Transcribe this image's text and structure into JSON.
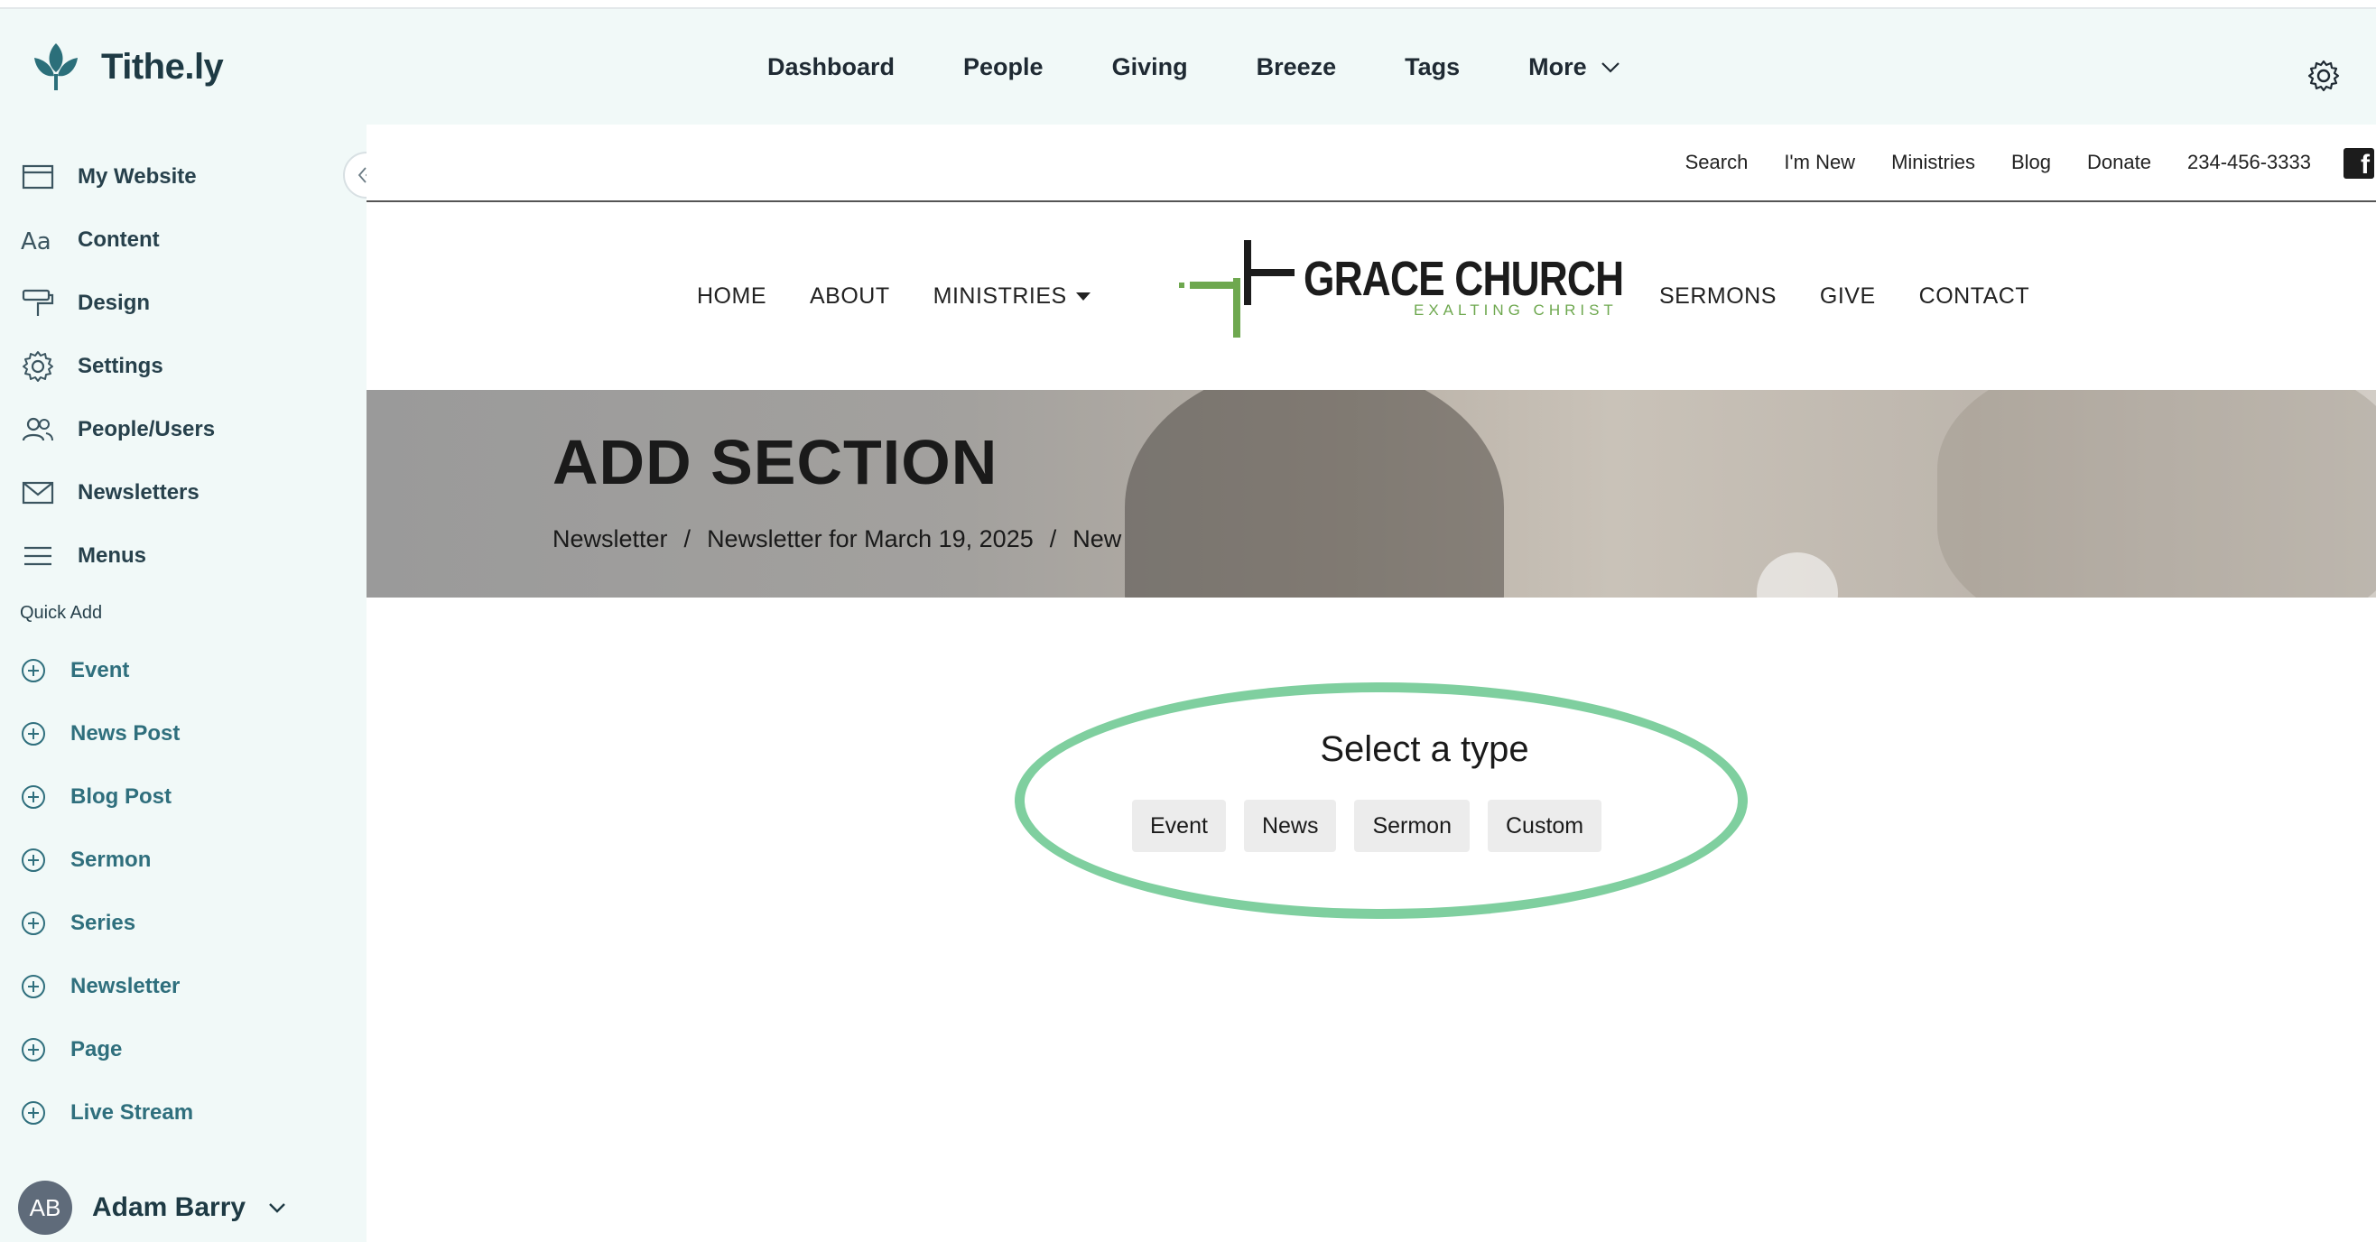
{
  "app": {
    "logo_text": "Tithe.ly"
  },
  "topnav": {
    "items": [
      "Dashboard",
      "People",
      "Giving",
      "Breeze",
      "Tags",
      "More"
    ]
  },
  "sidebar": {
    "items": [
      {
        "label": "My Website",
        "icon": "browser-window-icon"
      },
      {
        "label": "Content",
        "icon": "typography-icon"
      },
      {
        "label": "Design",
        "icon": "paint-roller-icon"
      },
      {
        "label": "Settings",
        "icon": "gear-icon"
      },
      {
        "label": "People/Users",
        "icon": "users-icon"
      },
      {
        "label": "Newsletters",
        "icon": "envelope-icon"
      },
      {
        "label": "Menus",
        "icon": "hamburger-menu-icon"
      }
    ],
    "quick_add_title": "Quick Add",
    "quick_add": [
      "Event",
      "News Post",
      "Blog Post",
      "Sermon",
      "Series",
      "Newsletter",
      "Page",
      "Live Stream"
    ],
    "user": {
      "initials": "AB",
      "name": "Adam Barry"
    }
  },
  "site": {
    "utility_links": [
      "Search",
      "I'm New",
      "Ministries",
      "Blog",
      "Donate",
      "234-456-3333"
    ],
    "nav_left": [
      "HOME",
      "ABOUT",
      "MINISTRIES"
    ],
    "nav_right": [
      "SERMONS",
      "GIVE",
      "CONTACT"
    ],
    "church_name": "GRACE CHURCH",
    "church_tagline": "EXALTING CHRIST",
    "hero_title": "ADD SECTION",
    "breadcrumb": [
      "Newsletter",
      "/",
      "Newsletter for March 19, 2025",
      "/",
      "New"
    ],
    "select_title": "Select a type",
    "type_buttons": [
      "Event",
      "News",
      "Sermon",
      "Custom"
    ]
  },
  "colors": {
    "sidebar_bg": "#f1f9f8",
    "accent_green": "#7fcf9f",
    "quick_add_text": "#2f6f7d",
    "logo_green": "#6ea84f"
  }
}
